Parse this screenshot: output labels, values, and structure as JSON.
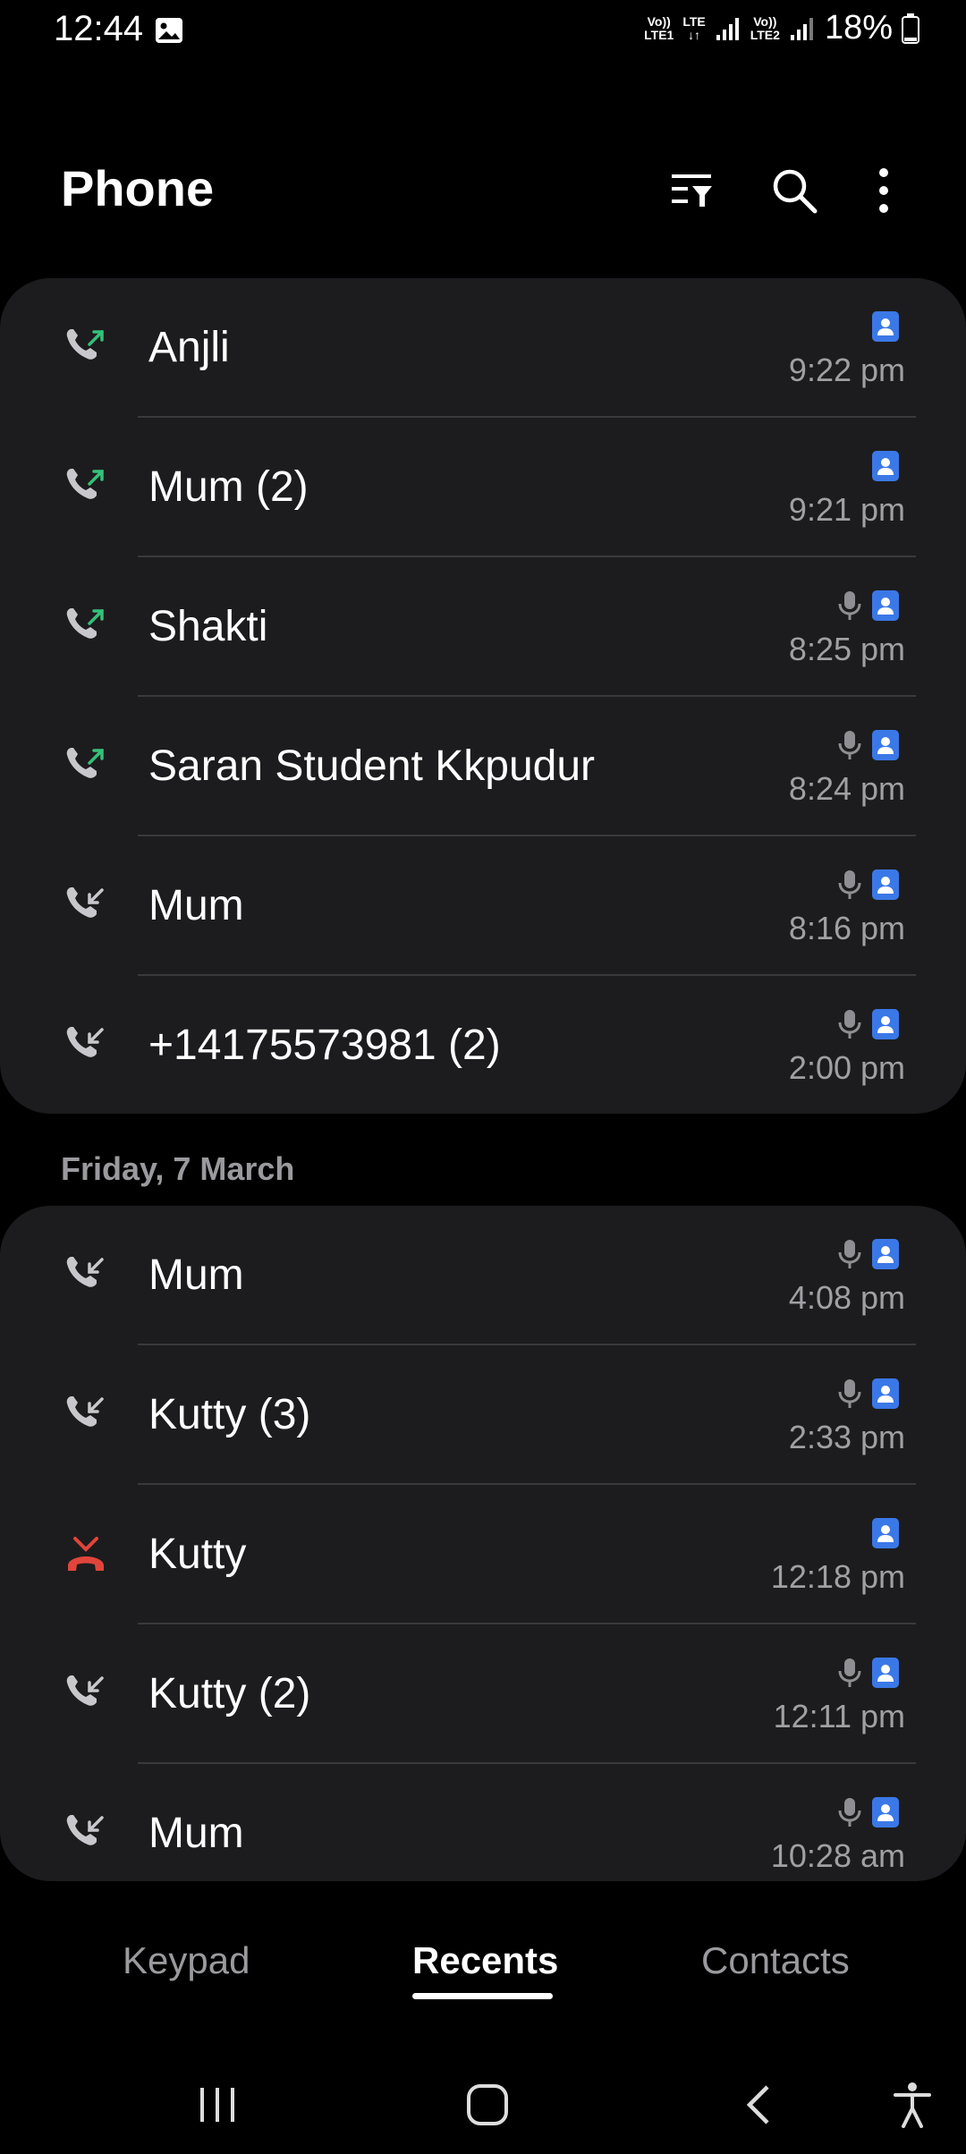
{
  "status_bar": {
    "time": "12:44",
    "sim1_top": "Vo))",
    "sim1_bottom": "LTE1",
    "lte_label": "LTE",
    "lte_arrows": "↓↑",
    "sim2_top": "Vo))",
    "sim2_bottom": "LTE2",
    "battery": "18%"
  },
  "header": {
    "title": "Phone",
    "filter_icon": "filter-icon",
    "search_icon": "search-icon",
    "more_icon": "more-options-icon"
  },
  "recents_today": [
    {
      "name": "Anjli",
      "time": "9:22 pm",
      "type": "outgoing",
      "mic": false
    },
    {
      "name": "Mum (2)",
      "time": "9:21 pm",
      "type": "outgoing",
      "mic": false
    },
    {
      "name": "Shakti",
      "time": "8:25 pm",
      "type": "outgoing",
      "mic": true
    },
    {
      "name": "Saran Student Kkpudur",
      "time": "8:24 pm",
      "type": "outgoing",
      "mic": true
    },
    {
      "name": "Mum",
      "time": "8:16 pm",
      "type": "incoming",
      "mic": true
    },
    {
      "name": "+14175573981 (2)",
      "time": "2:00 pm",
      "type": "incoming",
      "mic": true
    }
  ],
  "section_label": "Friday, 7 March",
  "recents_friday": [
    {
      "name": "Mum",
      "time": "4:08 pm",
      "type": "incoming",
      "mic": true
    },
    {
      "name": "Kutty (3)",
      "time": "2:33 pm",
      "type": "incoming",
      "mic": true
    },
    {
      "name": "Kutty",
      "time": "12:18 pm",
      "type": "missed",
      "mic": false
    },
    {
      "name": "Kutty (2)",
      "time": "12:11 pm",
      "type": "incoming",
      "mic": true
    },
    {
      "name": "Mum",
      "time": "10:28 am",
      "type": "incoming",
      "mic": true
    }
  ],
  "tabs": {
    "keypad": "Keypad",
    "recents": "Recents",
    "contacts": "Contacts",
    "active": "recents"
  },
  "colors": {
    "background": "#000000",
    "card": "#1c1c1e",
    "outgoing_arrow": "#34c17a",
    "missed": "#e0453a",
    "contact_badge": "#3b78e7",
    "secondary_text": "#a0a0a4"
  }
}
